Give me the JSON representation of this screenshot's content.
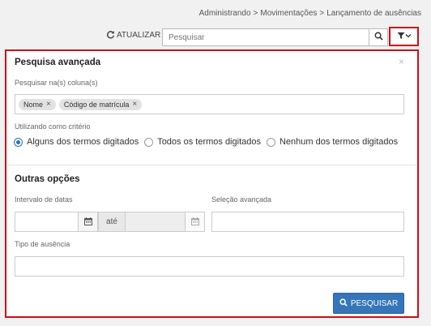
{
  "breadcrumb": {
    "items": [
      "Administrando",
      "Movimentações",
      "Lançamento de ausências"
    ],
    "separator": ">"
  },
  "toolbar": {
    "refresh_icon": "refresh-icon",
    "refresh_label": "ATUALIZAR",
    "search_placeholder": "Pesquisar",
    "search_icon": "search-icon",
    "filter_icon": "filter-icon"
  },
  "panel": {
    "title": "Pesquisa avançada",
    "close_glyph": "×",
    "columns_label": "Pesquisar na(s) coluna(s)",
    "tags": [
      {
        "label": "Nome",
        "remove": "×"
      },
      {
        "label": "Código de matrícula",
        "remove": "×"
      }
    ],
    "criteria_label": "Utilizando como critério",
    "criteria_options": [
      {
        "label": "Alguns dos termos digitados",
        "selected": true
      },
      {
        "label": "Todos os termos digitados",
        "selected": false
      },
      {
        "label": "Nenhum dos termos digitados",
        "selected": false
      }
    ],
    "other_title": "Outras opções",
    "date_range_label": "Intervalo de datas",
    "date_between": "até",
    "advanced_selection_label": "Seleção avançada",
    "absence_type_label": "Tipo de ausência",
    "submit_label": "PESQUISAR"
  },
  "colors": {
    "highlight": "#c8101a",
    "primary": "#3575b8"
  }
}
